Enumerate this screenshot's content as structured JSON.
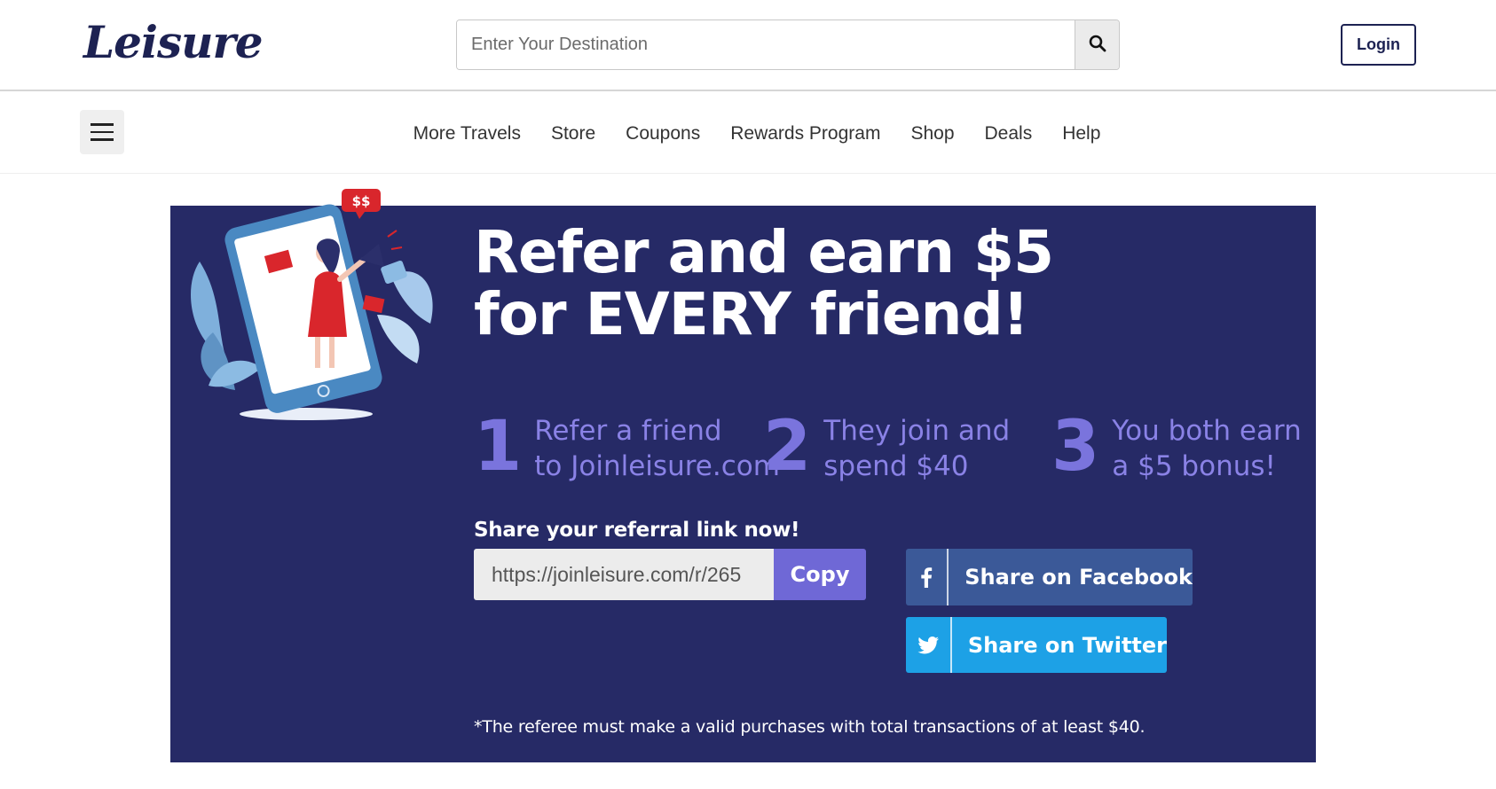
{
  "header": {
    "logo_text": "Leisure",
    "search_placeholder": "Enter Your Destination",
    "login_label": "Login"
  },
  "nav": {
    "items": [
      "More Travels",
      "Store",
      "Coupons",
      "Rewards Program",
      "Shop",
      "Deals",
      "Help"
    ]
  },
  "banner": {
    "headline_line1": "Refer and earn $5",
    "headline_line2": "for EVERY friend!",
    "steps": [
      {
        "num": "1",
        "line1": "Refer a friend",
        "line2": "to Joinleisure.com"
      },
      {
        "num": "2",
        "line1": "They join and",
        "line2": "spend $40"
      },
      {
        "num": "3",
        "line1": "You both earn",
        "line2": "a $5 bonus!"
      }
    ],
    "share_heading": "Share your referral link now!",
    "referral_link": "https://joinleisure.com/r/265",
    "copy_label": "Copy",
    "facebook_label": "Share on Facebook",
    "twitter_label": "Share on Twitter",
    "disclaimer": "*The referee must make a valid purchases with total transactions of at least $40.",
    "illustration_badge": "$$"
  },
  "colors": {
    "brand_navy": "#1d2252",
    "banner_bg": "#262a66",
    "accent_purple": "#6f68d6",
    "facebook_blue": "#3b5998",
    "twitter_blue": "#1da1e6"
  },
  "icons": {
    "search": "search-icon",
    "menu": "hamburger-menu-icon",
    "facebook": "facebook-icon",
    "twitter": "twitter-icon"
  }
}
